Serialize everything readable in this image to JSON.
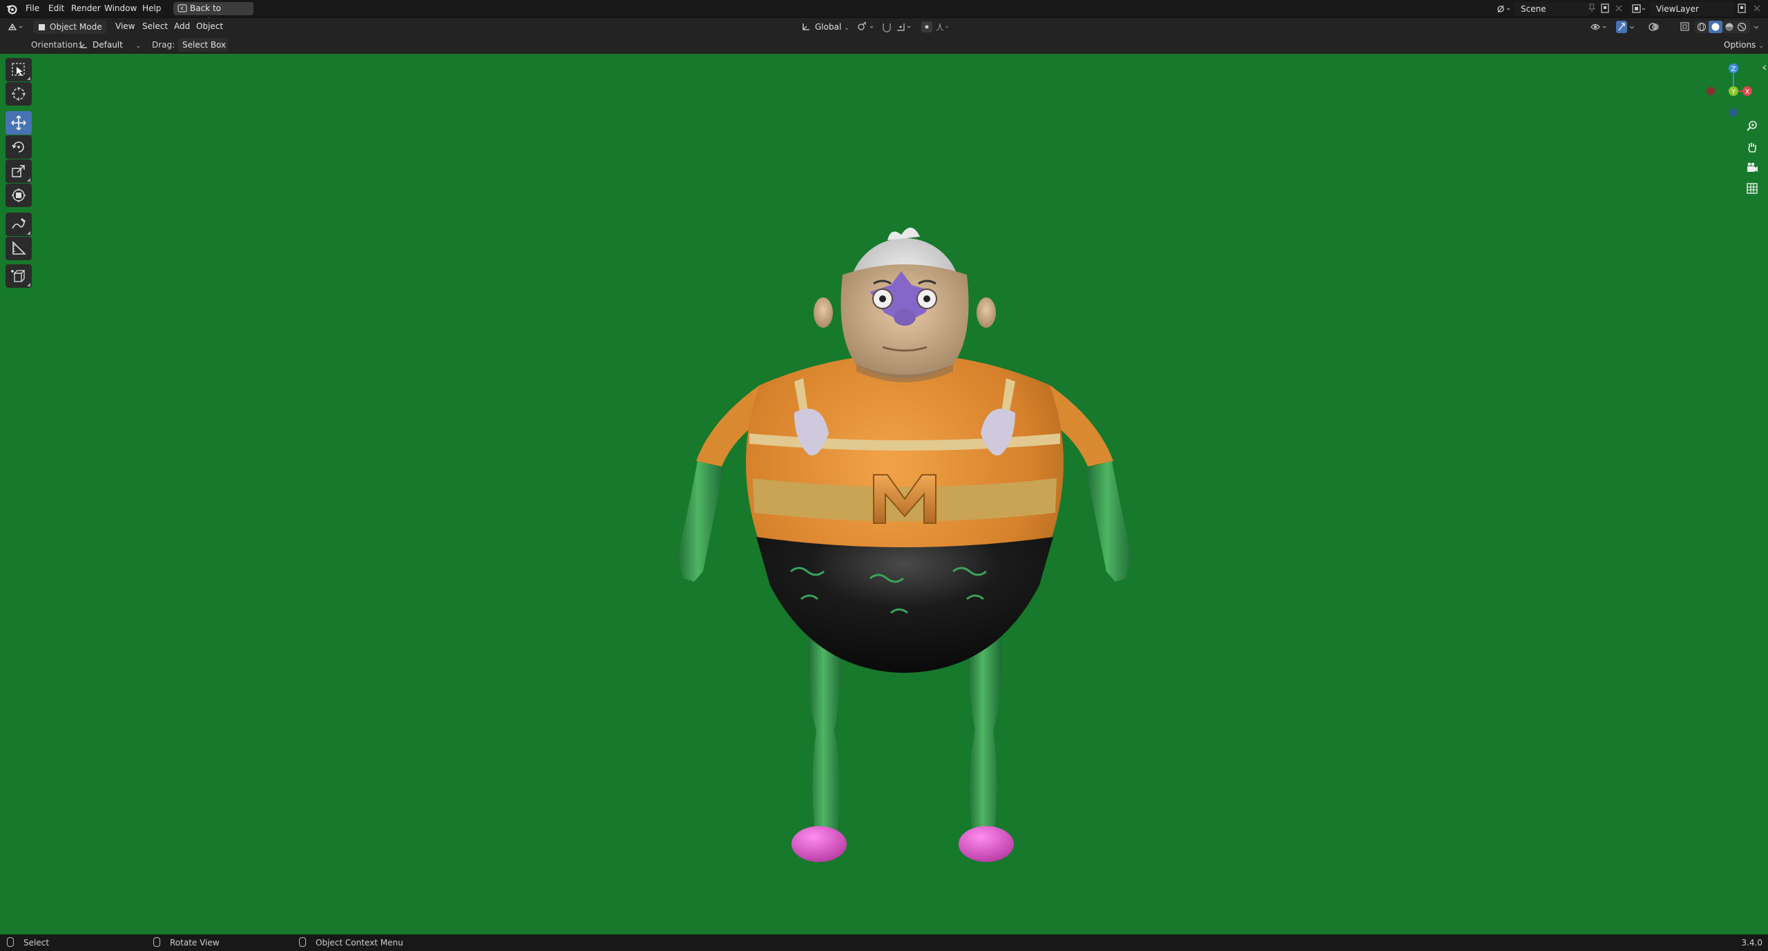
{
  "menu": {
    "items": [
      "File",
      "Edit",
      "Render",
      "Window",
      "Help"
    ],
    "back_button": "Back to Previous"
  },
  "scene": {
    "label": "Scene"
  },
  "view_layer": {
    "label": "ViewLayer"
  },
  "header": {
    "mode": "Object Mode",
    "menus": [
      "View",
      "Select",
      "Add",
      "Object"
    ],
    "transform_orientation": "Global"
  },
  "tool_settings": {
    "orientation_label": "Orientation:",
    "orientation_value": "Default",
    "drag_label": "Drag:",
    "drag_value": "Select Box",
    "options": "Options"
  },
  "toolbar": {
    "tools": [
      "select-box",
      "cursor",
      "move",
      "rotate",
      "scale",
      "transform",
      "annotate",
      "measure",
      "add-cube"
    ],
    "active_tool": "move"
  },
  "gizmo": {
    "x": "X",
    "y": "Y",
    "z": "Z"
  },
  "viewport": {
    "background_color": "#17792b",
    "model_letter": "M"
  },
  "status_bar": {
    "select": "Select",
    "rotate_view": "Rotate View",
    "context_menu": "Object Context Menu",
    "version": "3.4.0"
  },
  "colors": {
    "accent": "#4772b3",
    "gizmo_x": "#e0454f",
    "gizmo_y": "#8bc72a",
    "gizmo_z": "#3d8ee0"
  }
}
